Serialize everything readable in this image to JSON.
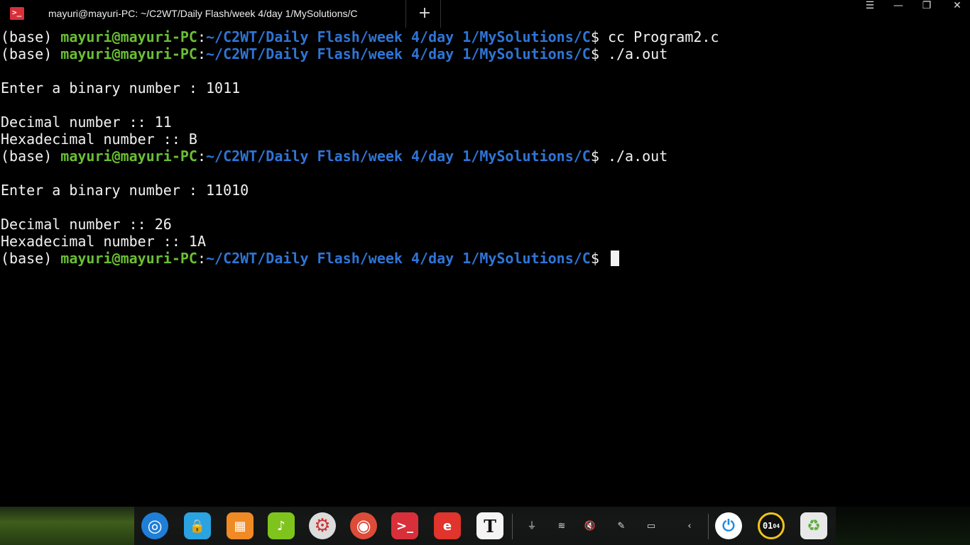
{
  "window": {
    "title": "mayuri@mayuri-PC: ~/C2WT/Daily Flash/week 4/day 1/MySolutions/C",
    "new_tab_glyph": "+",
    "menu_glyph": "☰",
    "minimize_glyph": "—",
    "maximize_glyph": "❐",
    "close_glyph": "✕"
  },
  "terminal": {
    "prompt": {
      "env": "(base) ",
      "user": "mayuri@mayuri-PC",
      "colon": ":",
      "path": "~/C2WT/Daily Flash/week 4/day 1/MySolutions/C",
      "dollar": "$ "
    },
    "lines": [
      {
        "type": "prompt",
        "cmd": "cc Program2.c"
      },
      {
        "type": "prompt",
        "cmd": "./a.out"
      },
      {
        "type": "text",
        "text": ""
      },
      {
        "type": "text",
        "text": "Enter a binary number : 1011"
      },
      {
        "type": "text",
        "text": ""
      },
      {
        "type": "text",
        "text": "Decimal number :: 11"
      },
      {
        "type": "text",
        "text": "Hexadecimal number :: B"
      },
      {
        "type": "prompt",
        "cmd": "./a.out"
      },
      {
        "type": "text",
        "text": ""
      },
      {
        "type": "text",
        "text": "Enter a binary number : 11010"
      },
      {
        "type": "text",
        "text": ""
      },
      {
        "type": "text",
        "text": "Decimal number :: 26"
      },
      {
        "type": "text",
        "text": "Hexadecimal number :: 1A"
      },
      {
        "type": "prompt",
        "cmd": "",
        "cursor": true
      }
    ]
  },
  "dock": {
    "apps": [
      {
        "name": "launcher-icon",
        "glyph": "◎",
        "color": "#1f7fd8"
      },
      {
        "name": "app-store-icon",
        "glyph": "🔒",
        "color": "#2aa3e0"
      },
      {
        "name": "file-manager-icon",
        "glyph": "▦",
        "color": "#f08a24"
      },
      {
        "name": "music-icon",
        "glyph": "♪",
        "color": "#7fc41c"
      },
      {
        "name": "settings-icon",
        "glyph": "⚙",
        "color": "#dcdcdc"
      },
      {
        "name": "chrome-icon",
        "glyph": "◉",
        "color": "#dd4b39"
      },
      {
        "name": "terminal-icon",
        "glyph": ">_",
        "color": "#d8303a"
      },
      {
        "name": "wps-icon",
        "glyph": "e",
        "color": "#e0342c"
      },
      {
        "name": "text-editor-icon",
        "glyph": "T",
        "color": "#f4f4f4"
      }
    ],
    "tray": [
      {
        "name": "usb-icon",
        "glyph": "⏚"
      },
      {
        "name": "wifi-icon",
        "glyph": "≋"
      },
      {
        "name": "volume-mute-icon",
        "glyph": "🔇"
      },
      {
        "name": "brush-icon",
        "glyph": "✎"
      },
      {
        "name": "battery-icon",
        "glyph": "▭"
      },
      {
        "name": "chevron-left-icon",
        "glyph": "‹"
      }
    ],
    "power_glyph": "⏻",
    "clock": {
      "hour": "01",
      "min": "04"
    },
    "trash_glyph": "♻"
  }
}
